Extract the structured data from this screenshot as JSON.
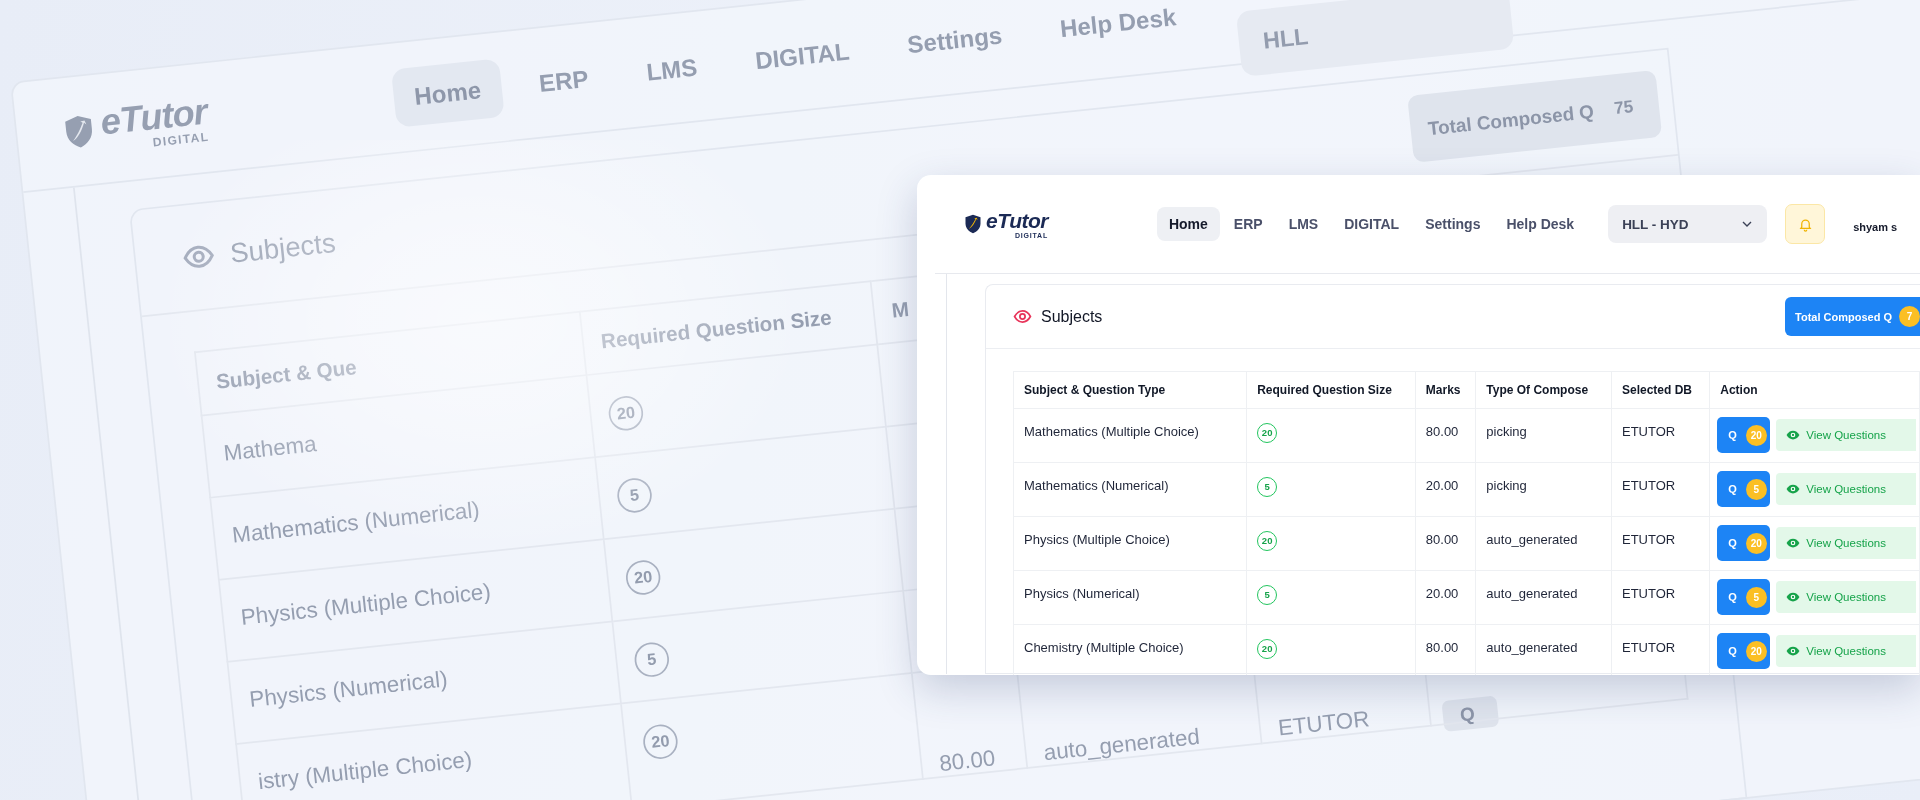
{
  "background_view": {
    "logo": {
      "name": "eTutor",
      "tagline": "DIGITAL"
    },
    "nav": [
      {
        "label": "Home",
        "selected": true
      },
      {
        "label": "ERP",
        "selected": false
      },
      {
        "label": "LMS",
        "selected": false
      },
      {
        "label": "DIGITAL",
        "selected": false
      },
      {
        "label": "Settings",
        "selected": false
      },
      {
        "label": "Help Desk",
        "selected": false
      }
    ],
    "branch_select": {
      "value": "HLL"
    },
    "subjects_panel": {
      "title": "Subjects",
      "total_button": {
        "label": "Total Composed Q",
        "count": "75"
      }
    },
    "table": {
      "columns": [
        "Subject & Que",
        "Required Question Size",
        "M"
      ],
      "rows": [
        {
          "subject": "Mathema",
          "size": "20"
        },
        {
          "subject": "Mathematics (Numerical)",
          "size": "5"
        },
        {
          "subject": "Physics (Multiple Choice)",
          "size": "20"
        },
        {
          "subject": "Physics (Numerical)",
          "size": "5"
        },
        {
          "subject": "istry (Multiple Choice)",
          "size": "20",
          "marks": "80.00",
          "compose_type": "auto_generated",
          "db": "ETUTOR",
          "action_label": "Q"
        }
      ]
    }
  },
  "app": {
    "logo": {
      "name": "eTutor",
      "tagline": "DIGITAL"
    },
    "nav": [
      {
        "label": "Home",
        "selected": true
      },
      {
        "label": "ERP",
        "selected": false
      },
      {
        "label": "LMS",
        "selected": false
      },
      {
        "label": "DIGITAL",
        "selected": false
      },
      {
        "label": "Settings",
        "selected": false
      },
      {
        "label": "Help Desk",
        "selected": false
      }
    ],
    "branch_select": {
      "value": "HLL - HYD"
    },
    "user_name": "shyam s",
    "subjects_panel": {
      "title": "Subjects",
      "total_button": {
        "label": "Total Composed Q",
        "count": "7"
      }
    },
    "table": {
      "columns": [
        "Subject & Question Type",
        "Required Question Size",
        "Marks",
        "Type Of Compose",
        "Selected DB",
        "Action"
      ],
      "rows": [
        {
          "subject": "Mathematics (Multiple Choice)",
          "size": "20",
          "marks": "80.00",
          "compose_type": "picking",
          "db": "ETUTOR",
          "question_button": {
            "label": "Q",
            "count": "20"
          },
          "view_button": "View Questions"
        },
        {
          "subject": "Mathematics (Numerical)",
          "size": "5",
          "marks": "20.00",
          "compose_type": "picking",
          "db": "ETUTOR",
          "question_button": {
            "label": "Q",
            "count": "5"
          },
          "view_button": "View Questions"
        },
        {
          "subject": "Physics (Multiple Choice)",
          "size": "20",
          "marks": "80.00",
          "compose_type": "auto_generated",
          "db": "ETUTOR",
          "question_button": {
            "label": "Q",
            "count": "20"
          },
          "view_button": "View Questions"
        },
        {
          "subject": "Physics (Numerical)",
          "size": "5",
          "marks": "20.00",
          "compose_type": "auto_generated",
          "db": "ETUTOR",
          "question_button": {
            "label": "Q",
            "count": "5"
          },
          "view_button": "View Questions"
        },
        {
          "subject": "Chemistry (Multiple Choice)",
          "size": "20",
          "marks": "80.00",
          "compose_type": "auto_generated",
          "db": "ETUTOR",
          "question_button": {
            "label": "Q",
            "count": "20"
          },
          "view_button": "View Questions"
        }
      ]
    }
  }
}
